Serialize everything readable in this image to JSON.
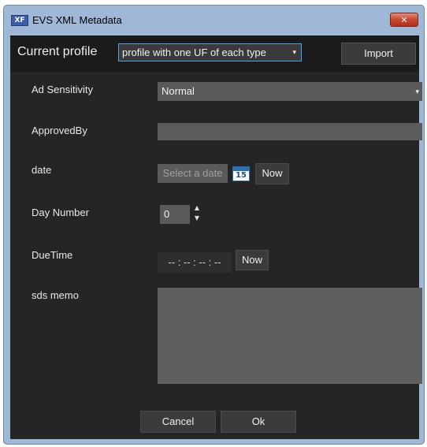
{
  "window": {
    "title": "EVS XML Metadata",
    "app_icon_text": "XF",
    "close_glyph": "✕"
  },
  "header": {
    "current_profile_label": "Current profile",
    "profile_value": "profile with one UF of each type",
    "import_label": "Import"
  },
  "fields": {
    "ad_sensitivity": {
      "label": "Ad Sensitivity",
      "value": "Normal"
    },
    "approved_by": {
      "label": "ApprovedBy",
      "value": ""
    },
    "date": {
      "label": "date",
      "placeholder": "Select a date",
      "calendar_day": "15",
      "now_label": "Now"
    },
    "day_number": {
      "label": "Day Number",
      "value": "0"
    },
    "due_time": {
      "label": "DueTime",
      "value": "-- : -- : -- : --",
      "now_label": "Now"
    },
    "sds_memo": {
      "label": "sds memo",
      "value": ""
    }
  },
  "footer": {
    "cancel_label": "Cancel",
    "ok_label": "Ok"
  },
  "icons": {
    "dropdown": "▾",
    "spin_up": "▲",
    "spin_down": "▼"
  },
  "colors": {
    "titlebar": "#9fb8d6",
    "client_bg": "#252525",
    "accent_border": "#4aa3e0",
    "close_button": "#c9462e"
  }
}
